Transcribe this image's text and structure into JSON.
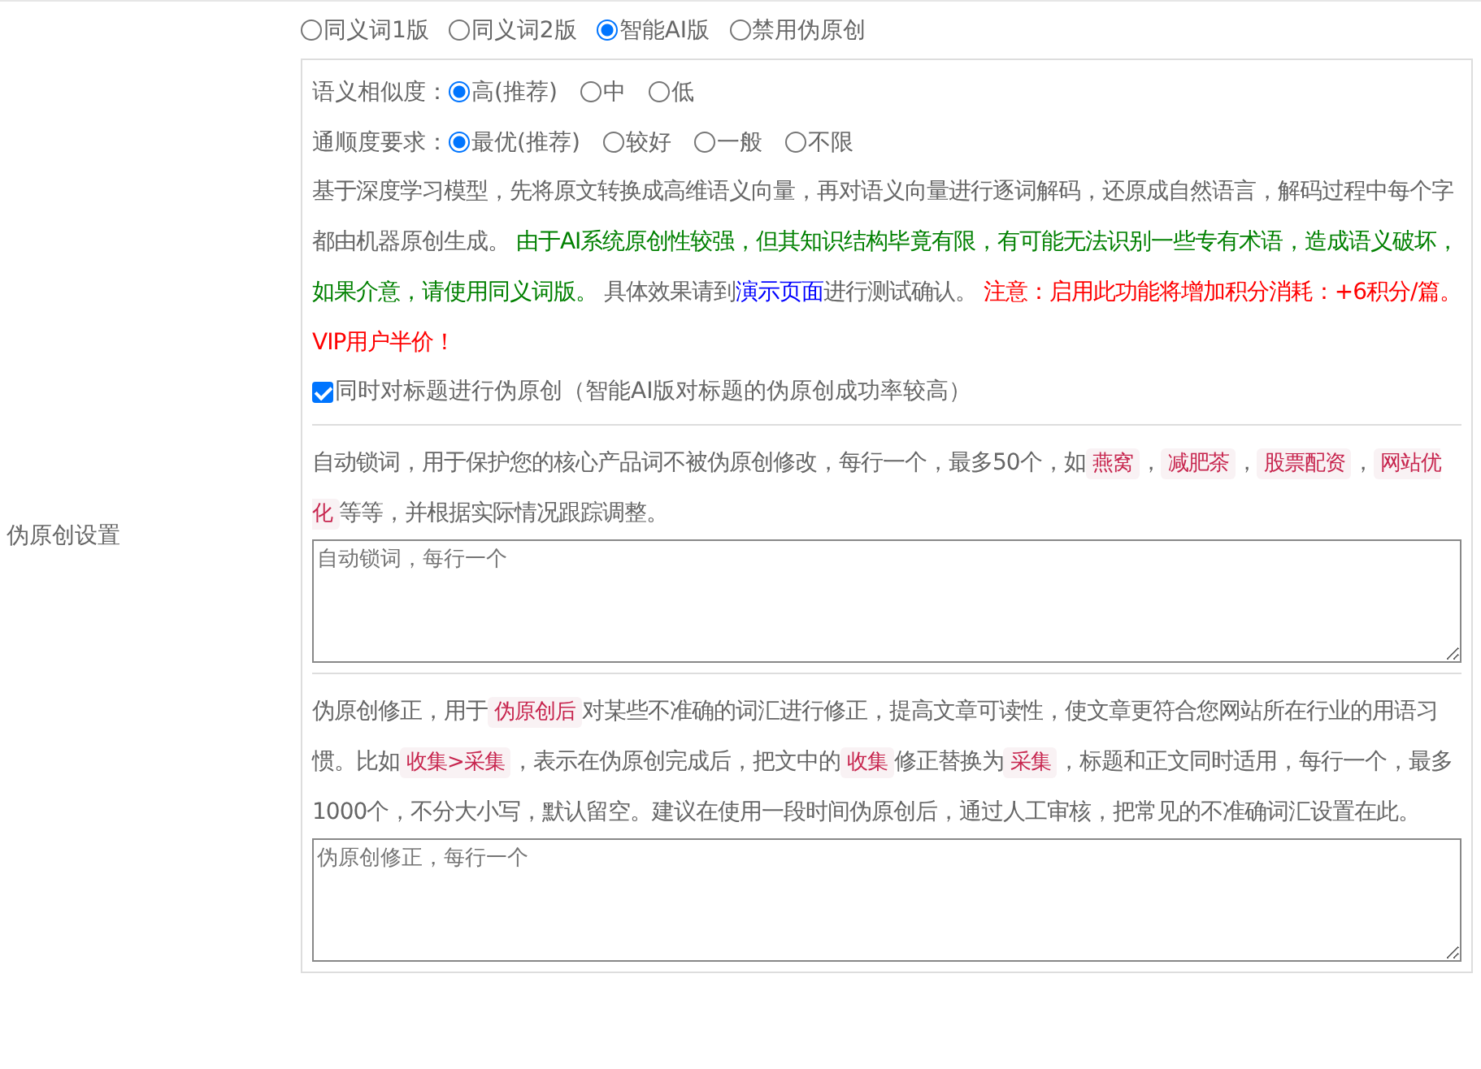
{
  "row_label": "伪原创设置",
  "modes": [
    {
      "label": "同义词1版",
      "selected": false
    },
    {
      "label": "同义词2版",
      "selected": false
    },
    {
      "label": "智能AI版",
      "selected": true
    },
    {
      "label": "禁用伪原创",
      "selected": false
    }
  ],
  "similarity": {
    "label": "语义相似度：",
    "options": [
      {
        "label": "高(推荐)",
        "selected": true
      },
      {
        "label": "中",
        "selected": false
      },
      {
        "label": "低",
        "selected": false
      }
    ]
  },
  "fluency": {
    "label": "通顺度要求：",
    "options": [
      {
        "label": "最优(推荐)",
        "selected": true
      },
      {
        "label": "较好",
        "selected": false
      },
      {
        "label": "一般",
        "selected": false
      },
      {
        "label": "不限",
        "selected": false
      }
    ]
  },
  "ai_description": [
    {
      "kind": "plain",
      "text": "基于深度学习模型，先将原文转换成高维语义向量，再对语义向量进行逐词解码，还原成自然语言，解码过程中每个字都由机器原创生成。 "
    },
    {
      "kind": "green",
      "text": "由于AI系统原创性较强，但其知识结构毕竟有限，有可能无法识别一些专有术语，造成语义破坏，如果介意，请使用同义词版。"
    },
    {
      "kind": "plain",
      "text": " 具体效果请到"
    },
    {
      "kind": "link",
      "text": "演示页面"
    },
    {
      "kind": "plain",
      "text": "进行测试确认。 "
    },
    {
      "kind": "red",
      "text": "注意：启用此功能将增加积分消耗：+6积分/篇。VIP用户半价！"
    }
  ],
  "title_option": {
    "checked": true,
    "label": "同时对标题进行伪原创（智能AI版对标题的伪原创成功率较高）"
  },
  "lock_words": {
    "description": [
      {
        "kind": "plain",
        "text": "自动锁词，用于保护您的核心产品词不被伪原创修改，每行一个，最多50个，如"
      },
      {
        "kind": "code",
        "text": "燕窝"
      },
      {
        "kind": "plain",
        "text": "，"
      },
      {
        "kind": "code",
        "text": "减肥茶"
      },
      {
        "kind": "plain",
        "text": "，"
      },
      {
        "kind": "code",
        "text": "股票配资"
      },
      {
        "kind": "plain",
        "text": "，"
      },
      {
        "kind": "code",
        "text": "网站优化"
      },
      {
        "kind": "plain",
        "text": "等等，并根据实际情况跟踪调整。"
      }
    ],
    "placeholder": "自动锁词，每行一个"
  },
  "corrections": {
    "description": [
      {
        "kind": "plain",
        "text": "伪原创修正，用于"
      },
      {
        "kind": "code",
        "text": "伪原创后"
      },
      {
        "kind": "plain",
        "text": "对某些不准确的词汇进行修正，提高文章可读性，使文章更符合您网站所在行业的用语习惯。比如"
      },
      {
        "kind": "code",
        "text": "收集>采集"
      },
      {
        "kind": "plain",
        "text": "，表示在伪原创完成后，把文中的"
      },
      {
        "kind": "code",
        "text": "收集"
      },
      {
        "kind": "plain",
        "text": "修正替换为"
      },
      {
        "kind": "code",
        "text": "采集"
      },
      {
        "kind": "plain",
        "text": "，标题和正文同时适用，每行一个，最多1000个，不分大小写，默认留空。建议在使用一段时间伪原创后，通过人工审核，把常见的不准确词汇设置在此。"
      }
    ],
    "placeholder": "伪原创修正，每行一个"
  }
}
